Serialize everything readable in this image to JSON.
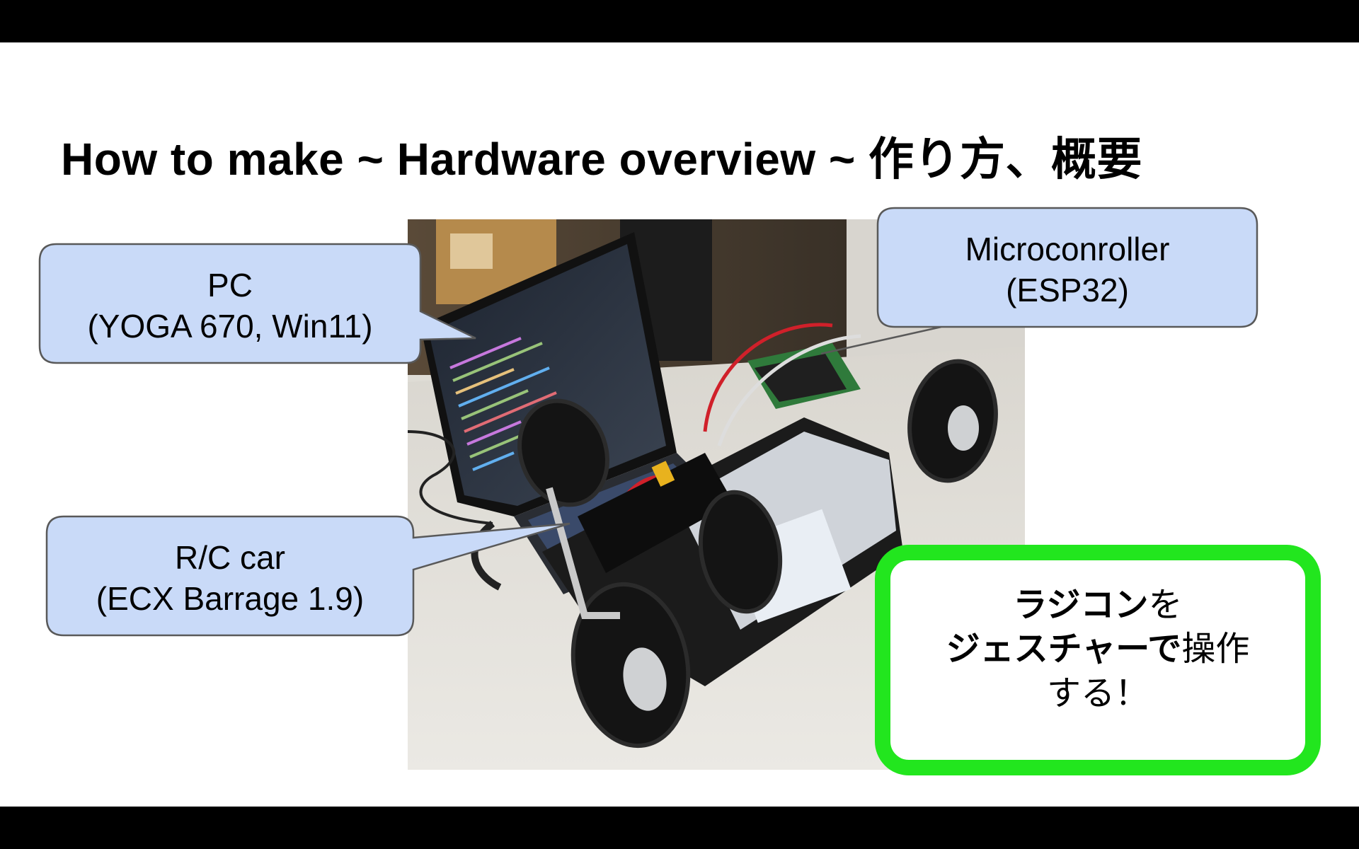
{
  "slide": {
    "title": "How to make ~ Hardware overview ~  作り方、概要"
  },
  "callouts": {
    "pc": {
      "line1": "PC",
      "line2": "(YOGA 670, Win11)"
    },
    "mcu": {
      "line1": "Microconroller",
      "line2": "(ESP32)"
    },
    "car": {
      "line1": "R/C car",
      "line2": "(ECX Barrage 1.9)"
    }
  },
  "highlight": {
    "line1_bold": "ラジコン",
    "line1_rest": "を",
    "line2_bold": "ジェスチャーで",
    "line2_rest": "操作",
    "line3": "する！"
  },
  "colors": {
    "callout_fill": "#c9daf8",
    "callout_stroke": "#595959",
    "highlight_border": "#22e61e"
  },
  "photo": {
    "description_icon": "rc-car-with-laptop-photo"
  }
}
